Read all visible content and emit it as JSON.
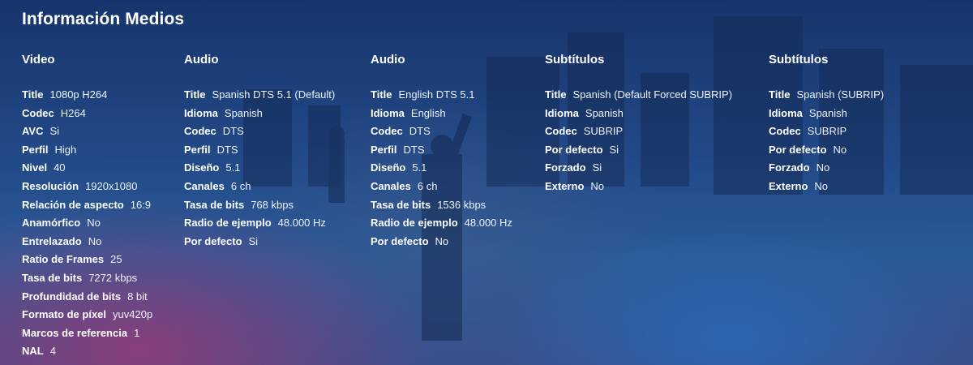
{
  "page_title": "Información Medios",
  "streams": [
    {
      "heading": "Video",
      "rows": [
        {
          "key": "Title",
          "value": "1080p H264"
        },
        {
          "key": "Codec",
          "value": "H264"
        },
        {
          "key": "AVC",
          "value": "Si"
        },
        {
          "key": "Perfil",
          "value": "High"
        },
        {
          "key": "Nivel",
          "value": "40"
        },
        {
          "key": "Resolución",
          "value": "1920x1080"
        },
        {
          "key": "Relación de aspecto",
          "value": "16:9"
        },
        {
          "key": "Anamórfico",
          "value": "No"
        },
        {
          "key": "Entrelazado",
          "value": "No"
        },
        {
          "key": "Ratio de Frames",
          "value": "25"
        },
        {
          "key": "Tasa de bits",
          "value": "7272 kbps"
        },
        {
          "key": "Profundidad de bits",
          "value": "8 bit"
        },
        {
          "key": "Formato de píxel",
          "value": "yuv420p"
        },
        {
          "key": "Marcos de referencia",
          "value": "1"
        },
        {
          "key": "NAL",
          "value": "4"
        }
      ]
    },
    {
      "heading": "Audio",
      "rows": [
        {
          "key": "Title",
          "value": "Spanish DTS 5.1 (Default)"
        },
        {
          "key": "Idioma",
          "value": "Spanish"
        },
        {
          "key": "Codec",
          "value": "DTS"
        },
        {
          "key": "Perfil",
          "value": "DTS"
        },
        {
          "key": "Diseño",
          "value": "5.1"
        },
        {
          "key": "Canales",
          "value": "6 ch"
        },
        {
          "key": "Tasa de bits",
          "value": "768 kbps"
        },
        {
          "key": "Radio de ejemplo",
          "value": "48.000 Hz"
        },
        {
          "key": "Por defecto",
          "value": "Si"
        }
      ]
    },
    {
      "heading": "Audio",
      "rows": [
        {
          "key": "Title",
          "value": "English DTS 5.1"
        },
        {
          "key": "Idioma",
          "value": "English"
        },
        {
          "key": "Codec",
          "value": "DTS"
        },
        {
          "key": "Perfil",
          "value": "DTS"
        },
        {
          "key": "Diseño",
          "value": "5.1"
        },
        {
          "key": "Canales",
          "value": "6 ch"
        },
        {
          "key": "Tasa de bits",
          "value": "1536 kbps"
        },
        {
          "key": "Radio de ejemplo",
          "value": "48.000 Hz"
        },
        {
          "key": "Por defecto",
          "value": "No"
        }
      ]
    },
    {
      "heading": "Subtítulos",
      "rows": [
        {
          "key": "Title",
          "value": "Spanish (Default Forced SUBRIP)"
        },
        {
          "key": "Idioma",
          "value": "Spanish"
        },
        {
          "key": "Codec",
          "value": "SUBRIP"
        },
        {
          "key": "Por defecto",
          "value": "Si"
        },
        {
          "key": "Forzado",
          "value": "Si"
        },
        {
          "key": "Externo",
          "value": "No"
        }
      ]
    },
    {
      "heading": "Subtítulos",
      "rows": [
        {
          "key": "Title",
          "value": "Spanish (SUBRIP)"
        },
        {
          "key": "Idioma",
          "value": "Spanish"
        },
        {
          "key": "Codec",
          "value": "SUBRIP"
        },
        {
          "key": "Por defecto",
          "value": "No"
        },
        {
          "key": "Forzado",
          "value": "No"
        },
        {
          "key": "Externo",
          "value": "No"
        }
      ]
    }
  ]
}
